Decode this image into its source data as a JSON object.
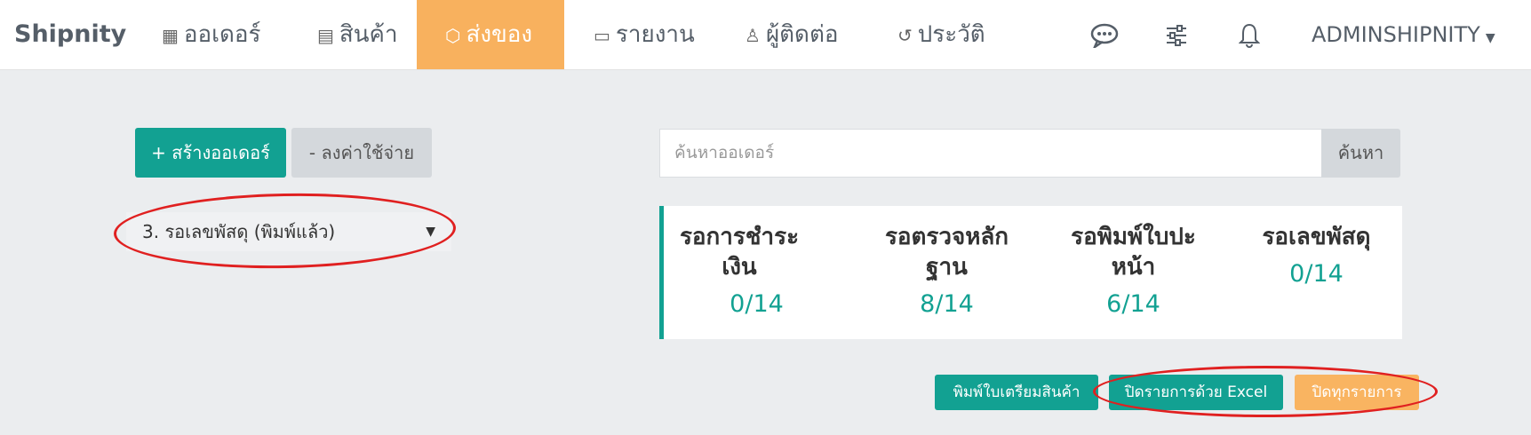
{
  "navbar": {
    "brand": "Shipnity",
    "items": [
      {
        "label": "ออเดอร์",
        "icon": "store-icon"
      },
      {
        "label": "สินค้า",
        "icon": "product-icon"
      },
      {
        "label": "ส่งของ",
        "icon": "box-icon",
        "active": true
      },
      {
        "label": "รายงาน",
        "icon": "report-icon"
      },
      {
        "label": "ผู้ติดต่อ",
        "icon": "user-icon"
      },
      {
        "label": "ประวัติ",
        "icon": "history-icon"
      }
    ],
    "right_icons": [
      "chat-icon",
      "sliders-icon",
      "bell-icon"
    ],
    "user": "ADMINSHIPNITY"
  },
  "actions": {
    "create_order": "+ สร้างออเดอร์",
    "record_expense": "- ลงค่าใช้จ่าย"
  },
  "status_select": {
    "value": "3. รอเลขพัสดุ (พิมพ์แล้ว)"
  },
  "search": {
    "placeholder": "ค้นหาออเดอร์",
    "button": "ค้นหา"
  },
  "stats": [
    {
      "title": "รอการชำระเงิน",
      "value": "0/14"
    },
    {
      "title": "รอตรวจหลักฐาน",
      "value": "8/14"
    },
    {
      "title": "รอพิมพ์ใบปะหน้า",
      "value": "6/14"
    },
    {
      "title": "รอเลขพัสดุ",
      "value": "0/14"
    }
  ],
  "bottom_buttons": {
    "print_prep": "พิมพ์ใบเตรียมสินค้า",
    "close_excel": "ปิดรายการด้วย Excel",
    "close_all": "ปิดทุกรายการ"
  },
  "colors": {
    "accent_teal": "#12a192",
    "active_orange": "#f8b15e",
    "annotation_red": "#e02020"
  }
}
